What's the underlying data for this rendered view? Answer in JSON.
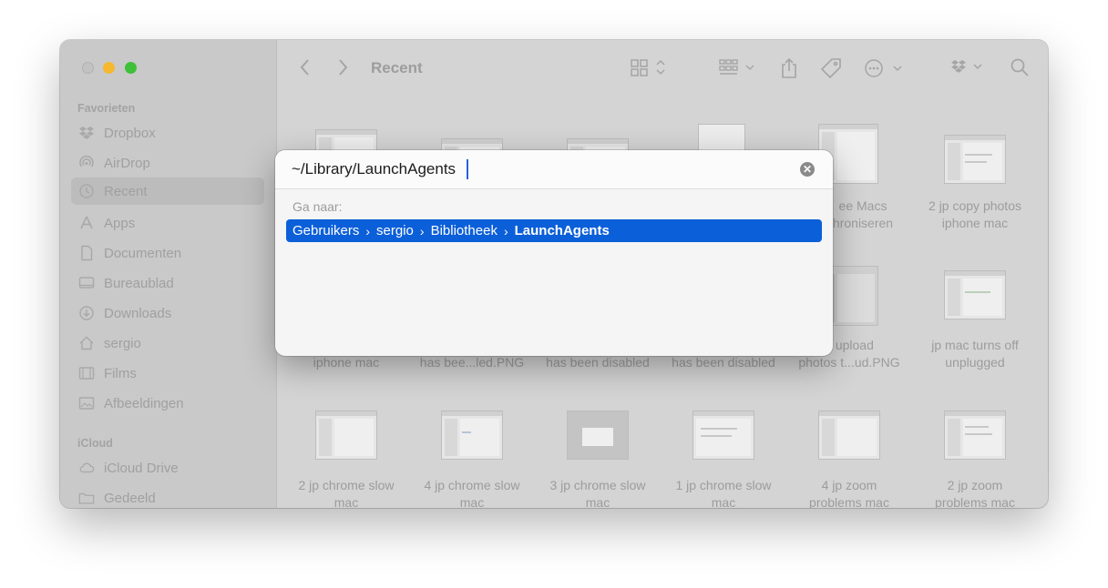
{
  "toolbar": {
    "title": "Recent",
    "icons": [
      "back-icon",
      "forward-icon",
      "icon-view-icon",
      "group-icon",
      "share-icon",
      "tag-icon",
      "more-icon",
      "dropbox-icon",
      "search-icon"
    ]
  },
  "sidebar": {
    "favorites_header": "Favorieten",
    "favorites": [
      {
        "label": "Dropbox",
        "icon": "dropbox-icon"
      },
      {
        "label": "AirDrop",
        "icon": "airdrop-icon"
      },
      {
        "label": "Recent",
        "icon": "clock-icon",
        "active": true
      },
      {
        "label": "Apps",
        "icon": "apps-icon"
      },
      {
        "label": "Documenten",
        "icon": "document-icon"
      },
      {
        "label": "Bureaublad",
        "icon": "desktop-icon"
      },
      {
        "label": "Downloads",
        "icon": "download-icon"
      },
      {
        "label": "sergio",
        "icon": "home-icon"
      },
      {
        "label": "Films",
        "icon": "film-icon"
      },
      {
        "label": "Afbeeldingen",
        "icon": "image-icon"
      }
    ],
    "icloud_header": "iCloud",
    "icloud": [
      {
        "label": "iCloud Drive",
        "icon": "cloud-icon"
      },
      {
        "label": "Gedeeld",
        "icon": "shared-folder-icon"
      }
    ]
  },
  "files": {
    "row1": [
      {
        "line1": "ee Macs",
        "line2": "hroniseren"
      },
      {
        "line1": "2 jp copy photos",
        "line2": "iphone mac"
      }
    ],
    "row2": [
      {
        "line1": "iphone mac",
        "line2": ""
      },
      {
        "line1": "has bee...led.PNG",
        "line2": ""
      },
      {
        "line1": "has been disabled",
        "line2": ""
      },
      {
        "line1": "has been disabled",
        "line2": ""
      },
      {
        "line1": "p upload",
        "line2": "photos t...ud.PNG"
      },
      {
        "line1": "jp mac turns off",
        "line2": "unplugged"
      }
    ],
    "row3": [
      {
        "line1": "2 jp chrome slow",
        "line2": "mac"
      },
      {
        "line1": "4 jp chrome slow",
        "line2": "mac"
      },
      {
        "line1": "3 jp chrome slow",
        "line2": "mac"
      },
      {
        "line1": "1 jp chrome slow",
        "line2": "mac"
      },
      {
        "line1": "4 jp zoom",
        "line2": "problems mac"
      },
      {
        "line1": "2 jp zoom",
        "line2": "problems mac"
      }
    ]
  },
  "goto_dialog": {
    "input_value": "~/Library/LaunchAgents",
    "section_label": "Ga naar:",
    "path_segments": [
      "Gebruikers",
      "sergio",
      "Bibliotheek",
      "LaunchAgents"
    ],
    "path_separator": "›"
  },
  "colors": {
    "highlight": "#0b5fd9",
    "traffic_min": "#f5b82e",
    "traffic_max": "#3ec03b"
  }
}
